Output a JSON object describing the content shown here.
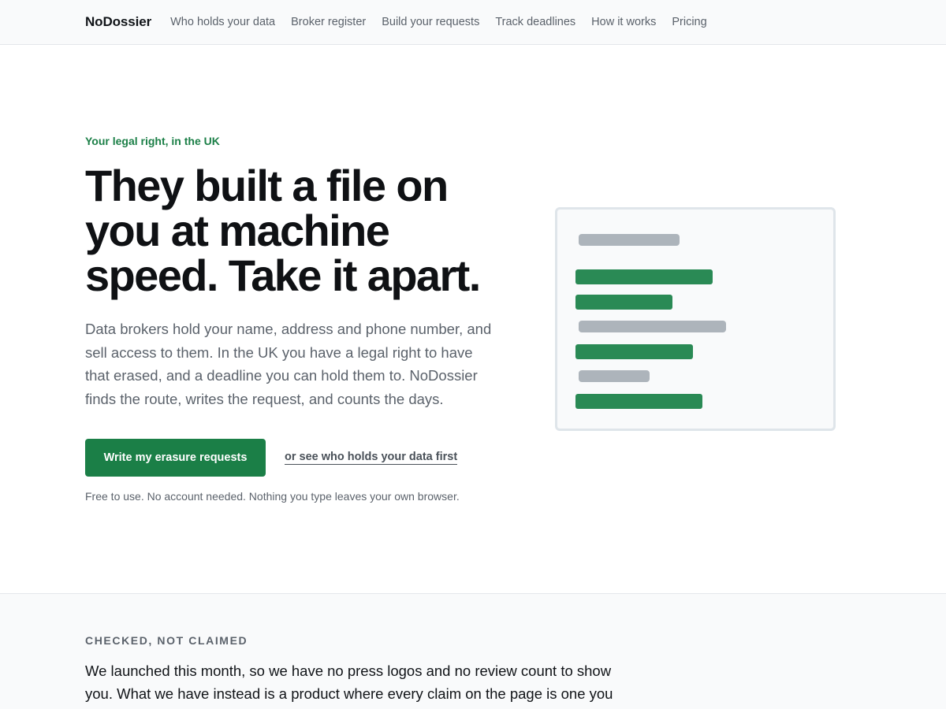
{
  "nav": {
    "brand": "NoDossier",
    "links": [
      "Who holds your data",
      "Broker register",
      "Build your requests",
      "Track deadlines",
      "How it works",
      "Pricing"
    ]
  },
  "hero": {
    "eyebrow": "Your legal right, in the UK",
    "headline": "They built a file on you at machine speed. Take it apart.",
    "lede": "Data brokers hold your name, address and phone number, and sell access to them. In the UK you have a legal right to have that erased, and a deadline you can hold them to. NoDossier finds the route, writes the request, and counts the days.",
    "cta_label": "Write my erasure requests",
    "secondary_label": "or see who holds your data first",
    "fineprint": "Free to use. No account needed. Nothing you type leaves your own browser."
  },
  "illustration": {
    "colors": {
      "grey": "#adb4bb",
      "green": "#2a8a55",
      "border": "#dfe5ea"
    },
    "rows": [
      {
        "kind": "grey"
      },
      {
        "kind": "green"
      },
      {
        "kind": "green"
      },
      {
        "kind": "grey"
      },
      {
        "kind": "green"
      },
      {
        "kind": "grey"
      },
      {
        "kind": "green"
      }
    ]
  },
  "section2": {
    "kicker": "CHECKED, NOT CLAIMED",
    "body": "We launched this month, so we have no press logos and no review count to show you. What we have instead is a product where every claim on the page is one you"
  },
  "colors": {
    "accent": "#1b7f47",
    "text": "#111418",
    "muted": "#5b626b"
  }
}
